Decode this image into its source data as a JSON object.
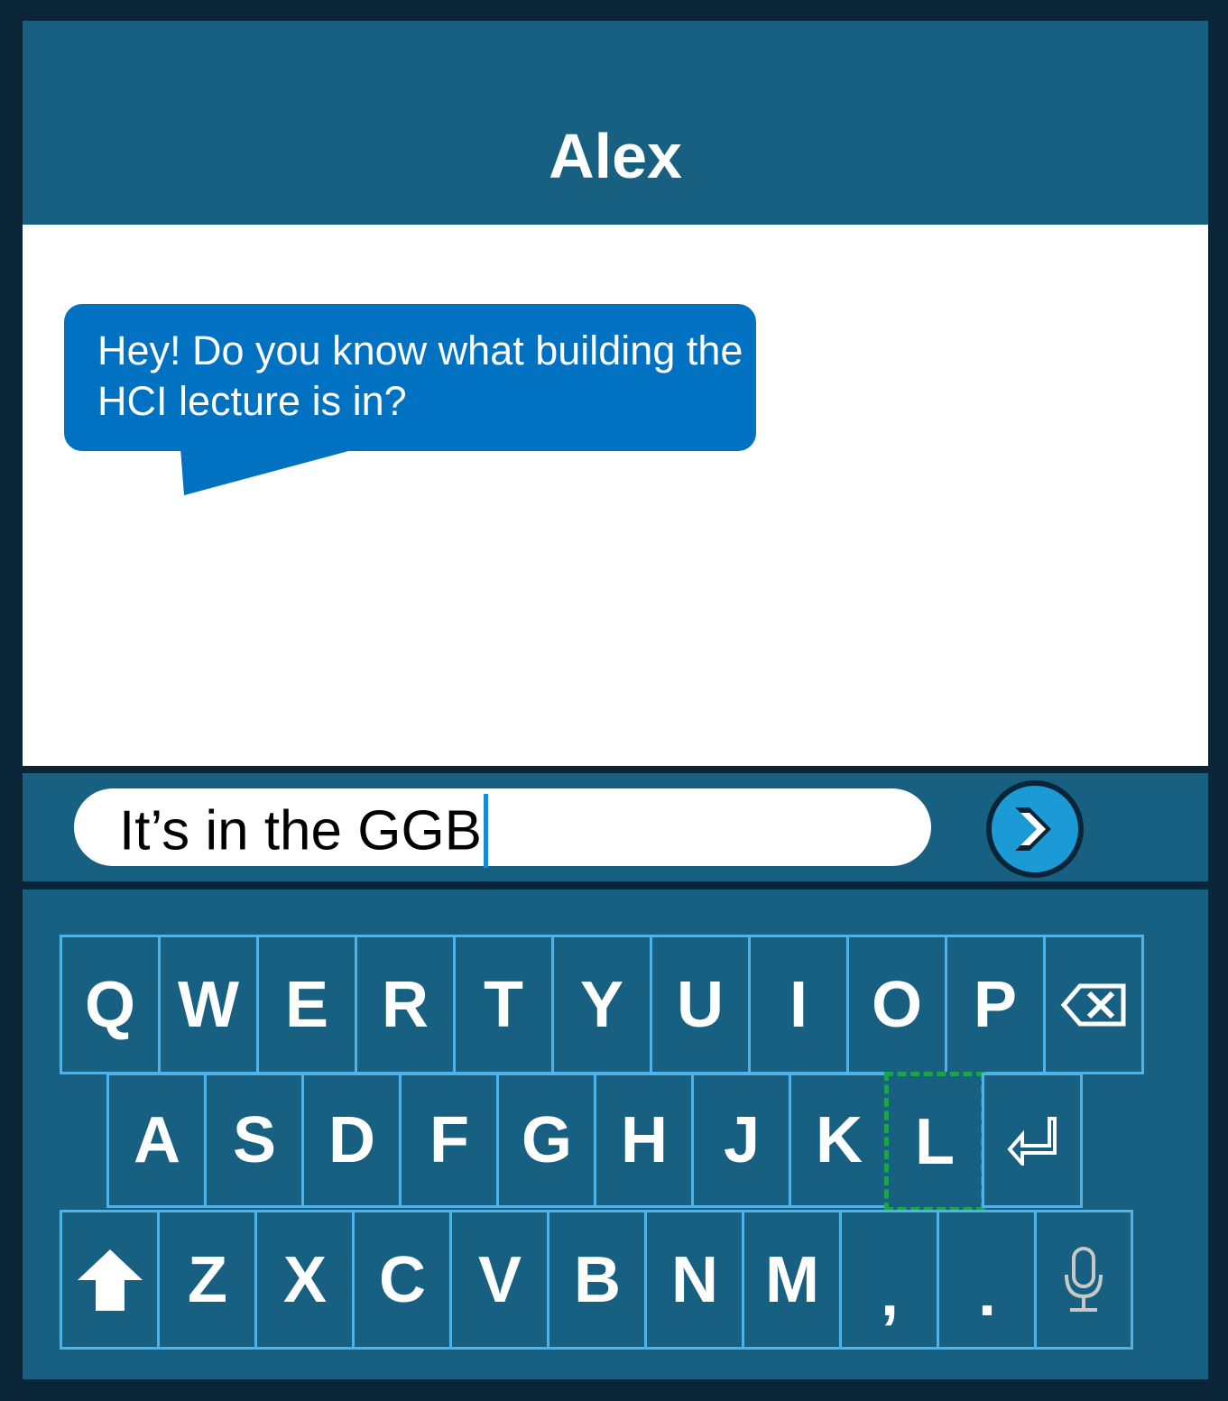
{
  "header": {
    "title": "Alex"
  },
  "conversation": {
    "messages": [
      {
        "sender": "Alex",
        "text": "Hey! Do you know what building the HCI lecture is in?"
      }
    ]
  },
  "compose": {
    "input_value": "It’s in the GGB",
    "send_icon": "double-chevron-right-icon"
  },
  "keyboard": {
    "row1": [
      "Q",
      "W",
      "E",
      "R",
      "T",
      "Y",
      "U",
      "I",
      "O",
      "P"
    ],
    "row2": [
      "A",
      "S",
      "D",
      "F",
      "G",
      "H",
      "J",
      "K",
      "L"
    ],
    "row3": [
      "Z",
      "X",
      "C",
      "V",
      "B",
      "N",
      "M",
      ",",
      "."
    ],
    "highlighted_key": "L",
    "icons": {
      "backspace": "backspace-icon",
      "enter": "return-icon",
      "shift": "shift-arrow-up-icon",
      "mic": "microphone-icon"
    }
  },
  "colors": {
    "frame": "#0b2538",
    "panel": "#186081",
    "bubble": "#0172c2",
    "key_border": "#4fb2e8",
    "focus_ring": "#1ca44a",
    "send": "#1b9ad6"
  }
}
